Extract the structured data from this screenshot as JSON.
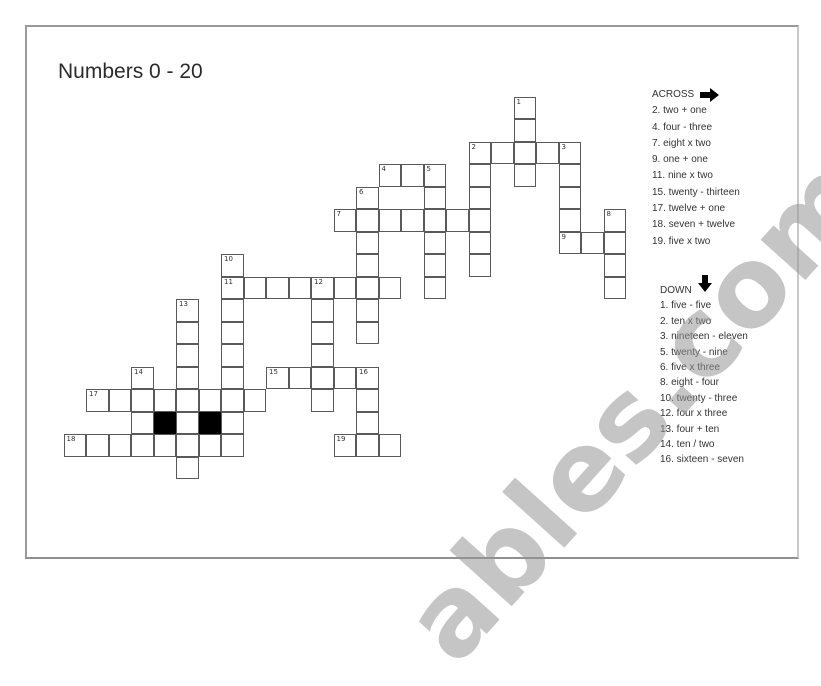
{
  "title": "Numbers 0 - 20",
  "across": {
    "heading": "ACROSS",
    "icon": "arrow-right-icon",
    "clues": [
      {
        "number": 2,
        "text": "2. two + one",
        "row": 2,
        "col": 18,
        "length": 5
      },
      {
        "number": 4,
        "text": "4. four - three",
        "row": 3,
        "col": 14,
        "length": 3
      },
      {
        "number": 7,
        "text": "7. eight x two",
        "row": 5,
        "col": 12,
        "length": 7
      },
      {
        "number": 9,
        "text": "9. one + one",
        "row": 6,
        "col": 22,
        "length": 3
      },
      {
        "number": 11,
        "text": "11. nine x two",
        "row": 8,
        "col": 7,
        "length": 8
      },
      {
        "number": 15,
        "text": "15. twenty - thirteen",
        "row": 12,
        "col": 9,
        "length": 5
      },
      {
        "number": 17,
        "text": "17. twelve + one",
        "row": 13,
        "col": 1,
        "length": 8
      },
      {
        "number": 18,
        "text": "18. seven + twelve",
        "row": 15,
        "col": 0,
        "length": 8
      },
      {
        "number": 19,
        "text": "19. five x two",
        "row": 15,
        "col": 12,
        "length": 3
      }
    ]
  },
  "down": {
    "heading": "DOWN",
    "icon": "arrow-down-icon",
    "clues": [
      {
        "number": 1,
        "text": "1. five - five",
        "row": 0,
        "col": 20,
        "length": 4
      },
      {
        "number": 2,
        "text": "2. ten x two",
        "row": 2,
        "col": 18,
        "length": 6
      },
      {
        "number": 3,
        "text": "3. nineteen - eleven",
        "row": 2,
        "col": 22,
        "length": 5
      },
      {
        "number": 5,
        "text": "5. twenty - nine",
        "row": 3,
        "col": 16,
        "length": 6
      },
      {
        "number": 6,
        "text": "6. five x three",
        "row": 4,
        "col": 13,
        "length": 7
      },
      {
        "number": 8,
        "text": "8. eight - four",
        "row": 5,
        "col": 24,
        "length": 4
      },
      {
        "number": 10,
        "text": "10. twenty - three",
        "row": 7,
        "col": 7,
        "length": 9
      },
      {
        "number": 12,
        "text": "12. four x three",
        "row": 8,
        "col": 11,
        "length": 6
      },
      {
        "number": 13,
        "text": "13. four + ten",
        "row": 9,
        "col": 5,
        "length": 8
      },
      {
        "number": 14,
        "text": "14. ten / two",
        "row": 12,
        "col": 3,
        "length": 4
      },
      {
        "number": 16,
        "text": "16. sixteen - seven",
        "row": 12,
        "col": 13,
        "length": 4
      }
    ]
  },
  "black_cells": [
    {
      "row": 14,
      "col": 4
    },
    {
      "row": 14,
      "col": 6
    }
  ],
  "watermark": "ables.com"
}
